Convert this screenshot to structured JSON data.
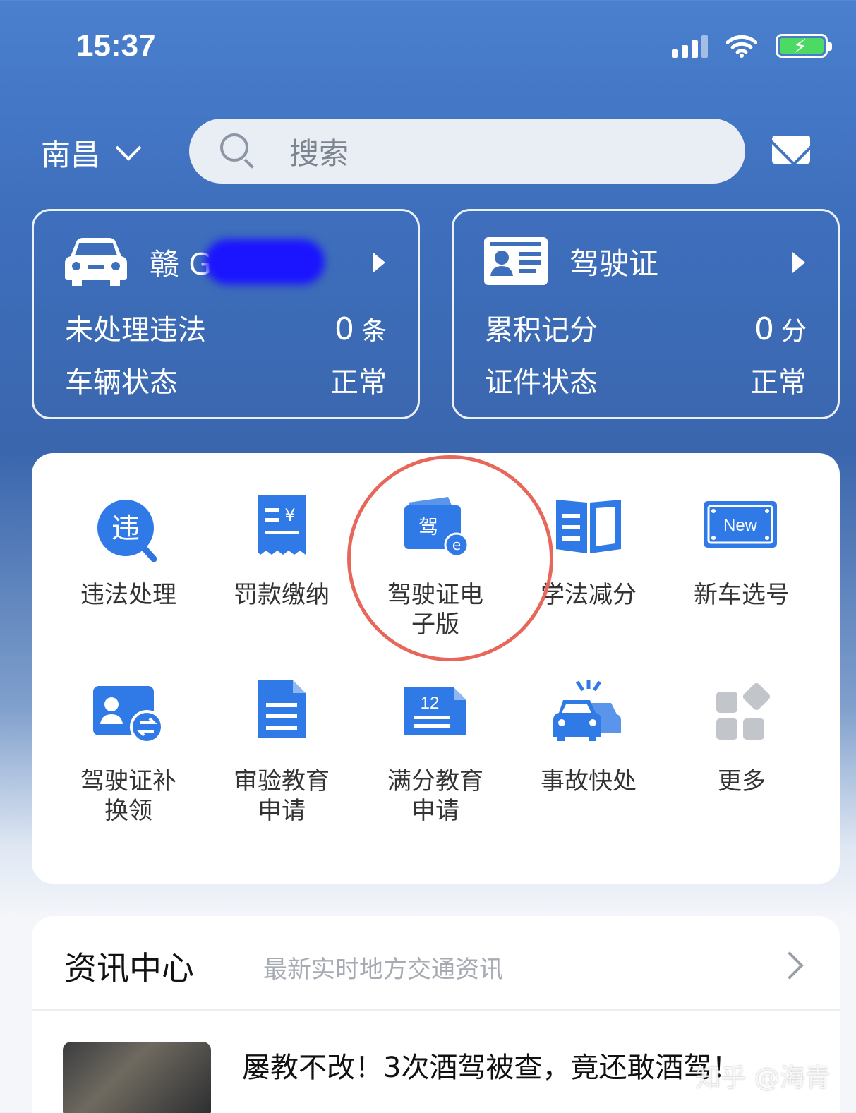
{
  "status_bar": {
    "time": "15:37"
  },
  "header": {
    "city": "南昌",
    "search_placeholder": "搜索"
  },
  "vehicle_card": {
    "plate": "赣 G",
    "row1_label": "未处理违法",
    "row1_value": "0",
    "row1_unit": "条",
    "row2_label": "车辆状态",
    "row2_value": "正常"
  },
  "license_card": {
    "title": "驾驶证",
    "row1_label": "累积记分",
    "row1_value": "0",
    "row1_unit": "分",
    "row2_label": "证件状态",
    "row2_value": "正常"
  },
  "services": [
    {
      "label": "违法处理",
      "icon": "violation-search-icon"
    },
    {
      "label": "罚款缴纳",
      "icon": "receipt-icon"
    },
    {
      "label": "驾驶证电子版",
      "icon": "e-license-icon"
    },
    {
      "label": "学法减分",
      "icon": "book-icon"
    },
    {
      "label": "新车选号",
      "icon": "new-plate-icon"
    },
    {
      "label": "驾驶证补换领",
      "icon": "license-exchange-icon"
    },
    {
      "label": "审验教育申请",
      "icon": "document-icon"
    },
    {
      "label": "满分教育申请",
      "icon": "calendar-doc-icon"
    },
    {
      "label": "事故快处",
      "icon": "car-accident-icon"
    },
    {
      "label": "更多",
      "icon": "more-grid-icon"
    }
  ],
  "service_glyphs": {
    "violation": "违",
    "elicense": "驾",
    "new_badge": "New",
    "calendar_num": "12"
  },
  "news": {
    "title": "资讯中心",
    "subtitle": "最新实时地方交通资讯",
    "headline": "屡教不改！3次酒驾被查，竟还敢酒驾！"
  },
  "watermark": "知乎 @海青",
  "colors": {
    "accent": "#3c7ee8",
    "highlight_circle": "#e7675b"
  }
}
